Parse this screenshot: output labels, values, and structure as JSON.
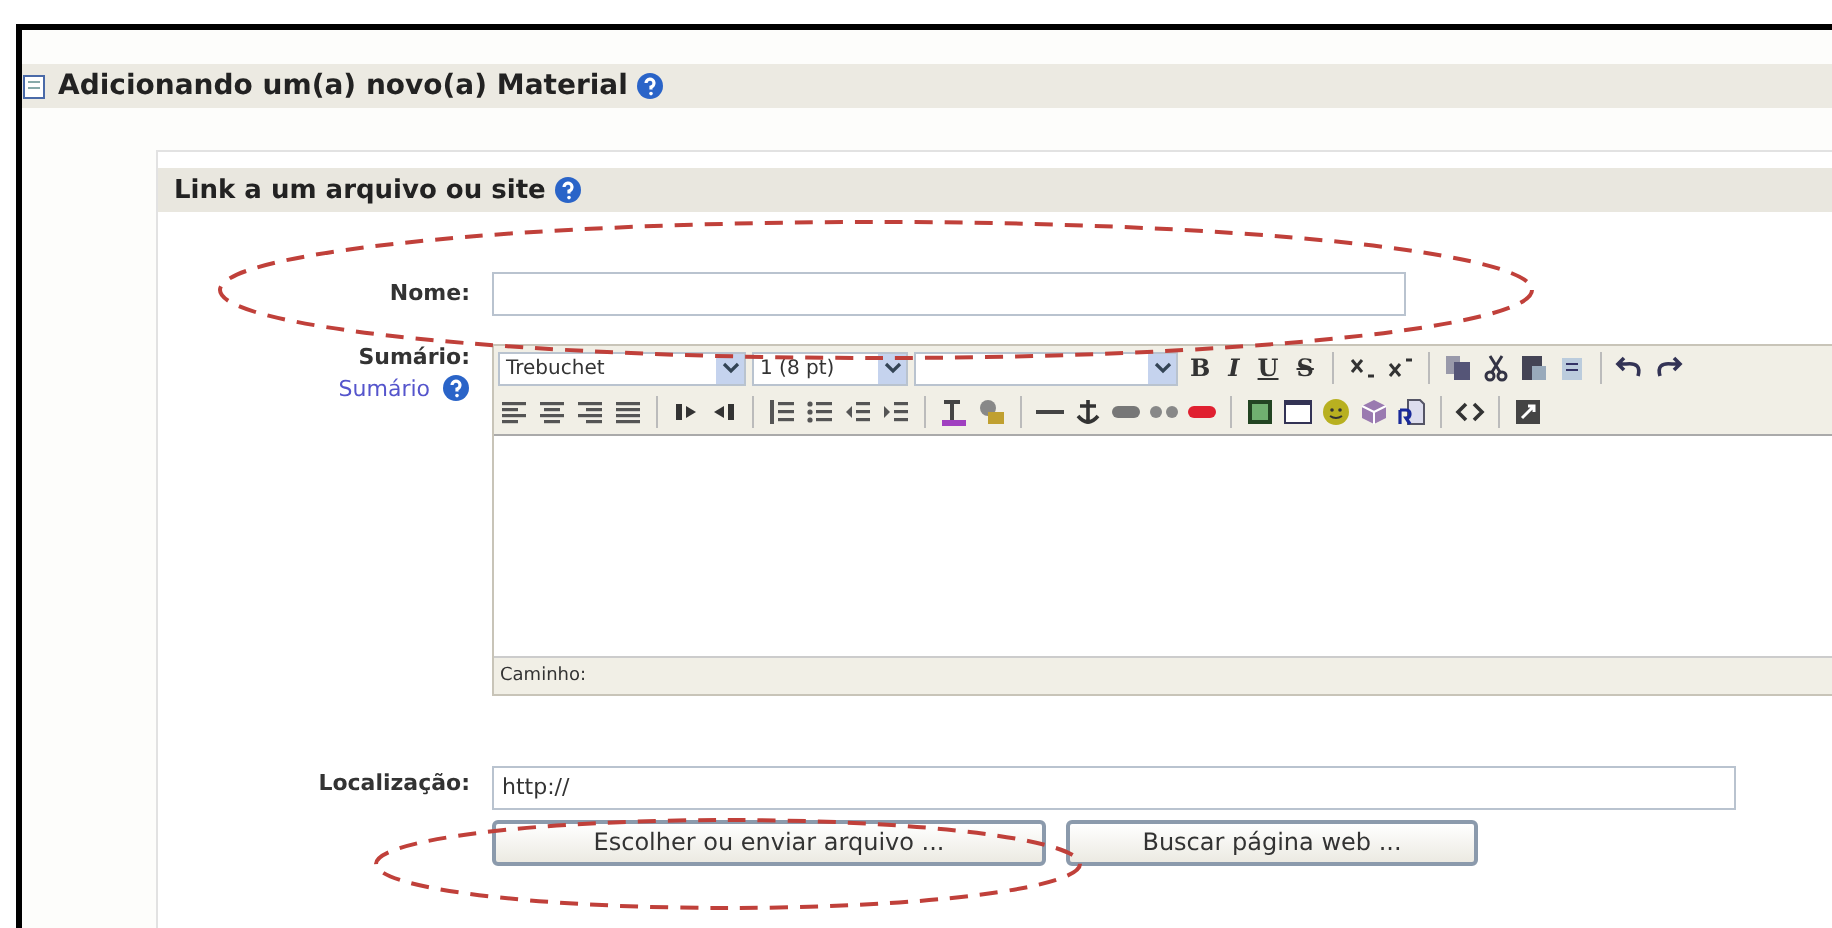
{
  "page_title": "Adicionando um(a) novo(a) Material",
  "section_title": "Link a um arquivo ou site",
  "name_field": {
    "label": "Nome:"
  },
  "summary": {
    "label": "Sumário:",
    "help_link": "Sumário",
    "font_select": "Trebuchet",
    "size_select": "1 (8 pt)",
    "format_buttons": [
      "B",
      "I",
      "U",
      "S"
    ],
    "path_label": "Caminho:"
  },
  "location": {
    "label": "Localização:",
    "value": "http://"
  },
  "buttons": [
    "Escolher ou enviar arquivo ...",
    "Buscar página web ..."
  ]
}
